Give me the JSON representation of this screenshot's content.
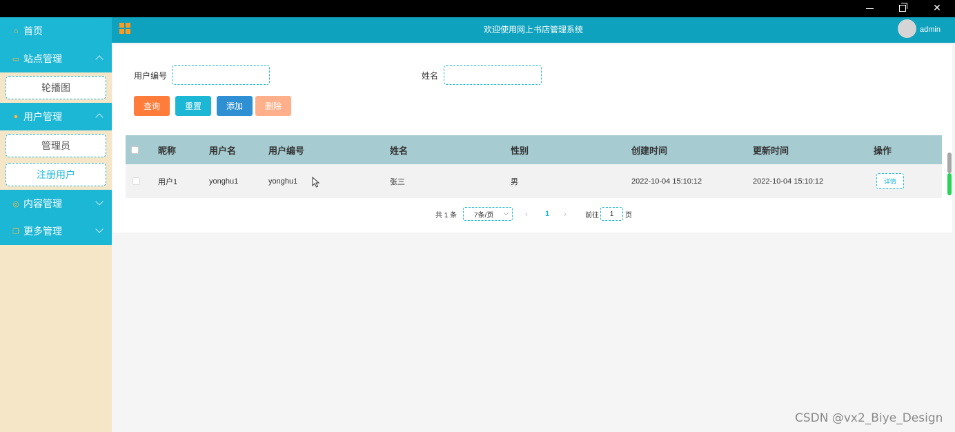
{
  "window": {
    "min_icon": "minimize-icon",
    "restore_icon": "restore-icon",
    "close_symbol": "✕"
  },
  "header": {
    "title": "欢迎使用网上书店管理系统",
    "username": "admin",
    "menu_icon": "grid-icon",
    "accent_color": "#0fa2be"
  },
  "sidebar": {
    "home": {
      "label": "首页",
      "icon": "home-icon"
    },
    "site": {
      "label": "站点管理",
      "icon": "monitor-icon",
      "items": [
        "轮播图"
      ]
    },
    "users": {
      "label": "用户管理",
      "icon": "user-icon",
      "items": [
        "管理员",
        "注册用户"
      ]
    },
    "content": {
      "label": "内容管理",
      "icon": "circle-icon"
    },
    "more": {
      "label": "更多管理",
      "icon": "copy-icon"
    }
  },
  "search": {
    "user_no_label": "用户编号",
    "user_no_value": "",
    "name_label": "姓名",
    "name_value": "",
    "buttons": {
      "query": "查询",
      "reset": "重置",
      "add": "添加",
      "delete": "删除"
    },
    "button_colors": {
      "query": "#ff7c3a",
      "reset": "#1cb7d5",
      "add": "#2f8fd3",
      "delete": "#ffb08a"
    }
  },
  "table": {
    "columns": [
      "昵称",
      "用户名",
      "用户编号",
      "姓名",
      "性别",
      "创建时间",
      "更新时间",
      "操作"
    ],
    "rows": [
      {
        "nickname": "用户1",
        "username": "yonghu1",
        "user_no": "yonghu1",
        "name": "张三",
        "gender": "男",
        "created": "2022-10-04 15:10:12",
        "updated": "2022-10-04 15:10:12",
        "action": "详情"
      }
    ]
  },
  "pagination": {
    "total": "共 1 条",
    "page_size": "7条/页",
    "prev": "‹",
    "current_page": "1",
    "next": "›",
    "goto_label": "前往",
    "goto_value": "1",
    "page_suffix": "页"
  },
  "watermark": "CSDN @vx2_Biye_Design"
}
